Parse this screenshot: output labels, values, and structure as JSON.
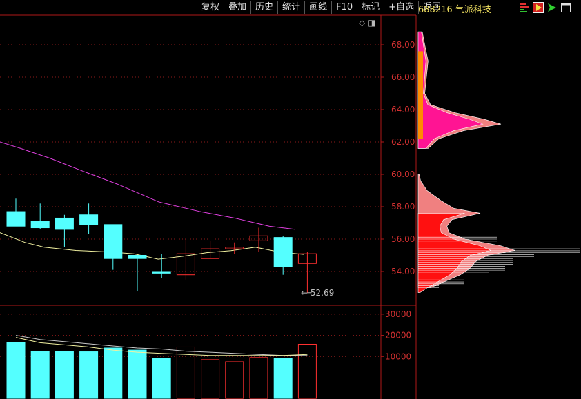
{
  "toolbar": {
    "items": [
      "复权",
      "叠加",
      "历史",
      "统计",
      "画线",
      "F10",
      "标记",
      "+自选",
      "返回"
    ]
  },
  "stock": {
    "code": "688216",
    "name": "气派科技"
  },
  "icons": [
    "chip-distribution-icon",
    "play-icon",
    "arrow-icon",
    "window-icon"
  ],
  "small_icons": [
    "diamond-icon",
    "panel-toggle-icon"
  ],
  "colors": {
    "up": "#ff3030",
    "down": "#54ffff",
    "ma_short": "#f0f0a0",
    "ma_long": "#e040e0",
    "grid": "#8b1a1a",
    "axis": "#b01818"
  },
  "chart_data": {
    "type": "candlestick",
    "price_axis": {
      "ticks": [
        "54.00",
        "56.00",
        "58.00",
        "60.00",
        "62.00",
        "64.00",
        "66.00",
        "68.00"
      ]
    },
    "volume_axis": {
      "ticks": [
        "10000",
        "20000",
        "30000"
      ]
    },
    "last_low_label": "52.69",
    "candles": [
      {
        "o": 57.7,
        "h": 58.5,
        "l": 56.8,
        "c": 56.8
      },
      {
        "o": 57.1,
        "h": 58.2,
        "l": 56.6,
        "c": 56.7
      },
      {
        "o": 57.3,
        "h": 57.5,
        "l": 55.5,
        "c": 56.6
      },
      {
        "o": 57.5,
        "h": 58.2,
        "l": 56.3,
        "c": 56.9
      },
      {
        "o": 56.9,
        "h": 56.9,
        "l": 54.1,
        "c": 54.8
      },
      {
        "o": 55.0,
        "h": 55.0,
        "l": 52.8,
        "c": 54.8
      },
      {
        "o": 54.0,
        "h": 55.1,
        "l": 53.6,
        "c": 53.9
      },
      {
        "o": 53.8,
        "h": 56.0,
        "l": 53.5,
        "c": 55.1
      },
      {
        "o": 54.8,
        "h": 55.9,
        "l": 54.8,
        "c": 55.4
      },
      {
        "o": 55.4,
        "h": 55.8,
        "l": 55.1,
        "c": 55.5
      },
      {
        "o": 55.9,
        "h": 56.7,
        "l": 55.2,
        "c": 56.2
      },
      {
        "o": 56.1,
        "h": 56.2,
        "l": 53.8,
        "c": 54.3
      },
      {
        "o": 54.5,
        "h": 55.2,
        "l": 52.69,
        "c": 55.1
      }
    ],
    "volumes": [
      16500,
      12500,
      12500,
      12200,
      14000,
      13000,
      9200,
      14500,
      8500,
      7500,
      9500,
      9200,
      15800
    ],
    "ma_short_points": [
      [
        0,
        56.4
      ],
      [
        36,
        55.8
      ],
      [
        64,
        55.5
      ],
      [
        110,
        55.3
      ],
      [
        160,
        55.2
      ]
    ],
    "ma_long_points": [
      [
        0,
        62.0
      ],
      [
        30,
        61.6
      ],
      [
        72,
        61.0
      ],
      [
        120,
        60.2
      ],
      [
        170,
        59.4
      ],
      [
        230,
        58.3
      ],
      [
        290,
        57.7
      ],
      [
        340,
        57.3
      ],
      [
        390,
        56.8
      ],
      [
        428,
        56.6
      ]
    ],
    "vol_ma_short": [
      19000,
      16500,
      15500,
      14500,
      13000,
      12000,
      11500,
      11000,
      10500,
      10500,
      10500,
      10500,
      11000
    ],
    "vol_ma_long": [
      20000,
      18000,
      17000,
      16000,
      15000,
      14000,
      13500,
      12500,
      12000,
      11500,
      11000,
      10500,
      10500
    ],
    "chip_profile": [
      {
        "p": 68.8,
        "v": 0.05
      },
      {
        "p": 68.0,
        "v": 0.08
      },
      {
        "p": 67.0,
        "v": 0.12
      },
      {
        "p": 66.0,
        "v": 0.1
      },
      {
        "p": 65.0,
        "v": 0.08
      },
      {
        "p": 64.3,
        "v": 0.15
      },
      {
        "p": 63.8,
        "v": 0.45
      },
      {
        "p": 63.4,
        "v": 0.8
      },
      {
        "p": 63.1,
        "v": 1.0
      },
      {
        "p": 62.7,
        "v": 0.55
      },
      {
        "p": 62.2,
        "v": 0.25
      },
      {
        "p": 61.6,
        "v": 0.12
      },
      {
        "p": 61.0,
        "v": 0.06
      },
      {
        "p": 60.5,
        "v": 0.04
      },
      {
        "p": 60.0,
        "v": 0.02
      },
      {
        "p": 59.6,
        "v": 0.05
      },
      {
        "p": 59.0,
        "v": 0.18
      },
      {
        "p": 58.4,
        "v": 0.45
      },
      {
        "p": 57.9,
        "v": 0.72
      },
      {
        "p": 57.6,
        "v": 1.25
      },
      {
        "p": 57.2,
        "v": 0.68
      },
      {
        "p": 56.8,
        "v": 0.58
      },
      {
        "p": 56.4,
        "v": 0.62
      },
      {
        "p": 56.0,
        "v": 0.95
      },
      {
        "p": 55.6,
        "v": 1.65
      },
      {
        "p": 55.3,
        "v": 1.95
      },
      {
        "p": 55.0,
        "v": 1.4
      },
      {
        "p": 54.6,
        "v": 1.15
      },
      {
        "p": 54.2,
        "v": 1.05
      },
      {
        "p": 53.8,
        "v": 0.85
      },
      {
        "p": 53.4,
        "v": 0.55
      },
      {
        "p": 53.0,
        "v": 0.25
      },
      {
        "p": 52.7,
        "v": 0.05
      }
    ]
  }
}
